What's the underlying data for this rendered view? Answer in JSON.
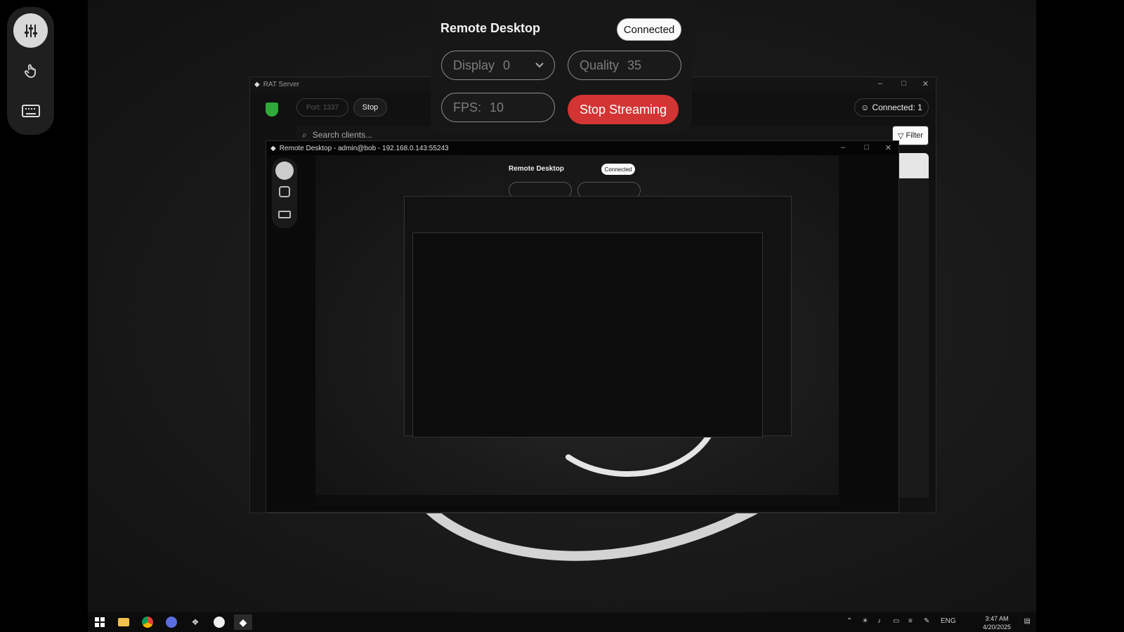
{
  "remote_panel": {
    "title": "Remote Desktop",
    "status": "Connected",
    "display_label": "Display",
    "display_value": "0",
    "quality_label": "Quality",
    "quality_value": "35",
    "fps_label": "FPS:",
    "fps_value": "10",
    "stop_button": "Stop Streaming"
  },
  "dock": {
    "icons": [
      "sliders-icon",
      "hand-pointer-icon",
      "keyboard-icon"
    ]
  },
  "rat_window": {
    "title": "RAT Server",
    "port_placeholder": "Port: 1337",
    "stop_label": "Stop",
    "connected_label": "Connected: 1",
    "search_placeholder": "Search clients...",
    "filter_label": "Filter"
  },
  "remote_window": {
    "title": "Remote Desktop - admin@bob - 192.168.0.143:55243"
  },
  "taskbar": {
    "language": "ENG",
    "time": "3:47 AM",
    "date": "4/20/2025"
  },
  "colors": {
    "stop_red": "#d33434",
    "shield_green": "#2faa3a",
    "panel_bg": "#171717"
  }
}
